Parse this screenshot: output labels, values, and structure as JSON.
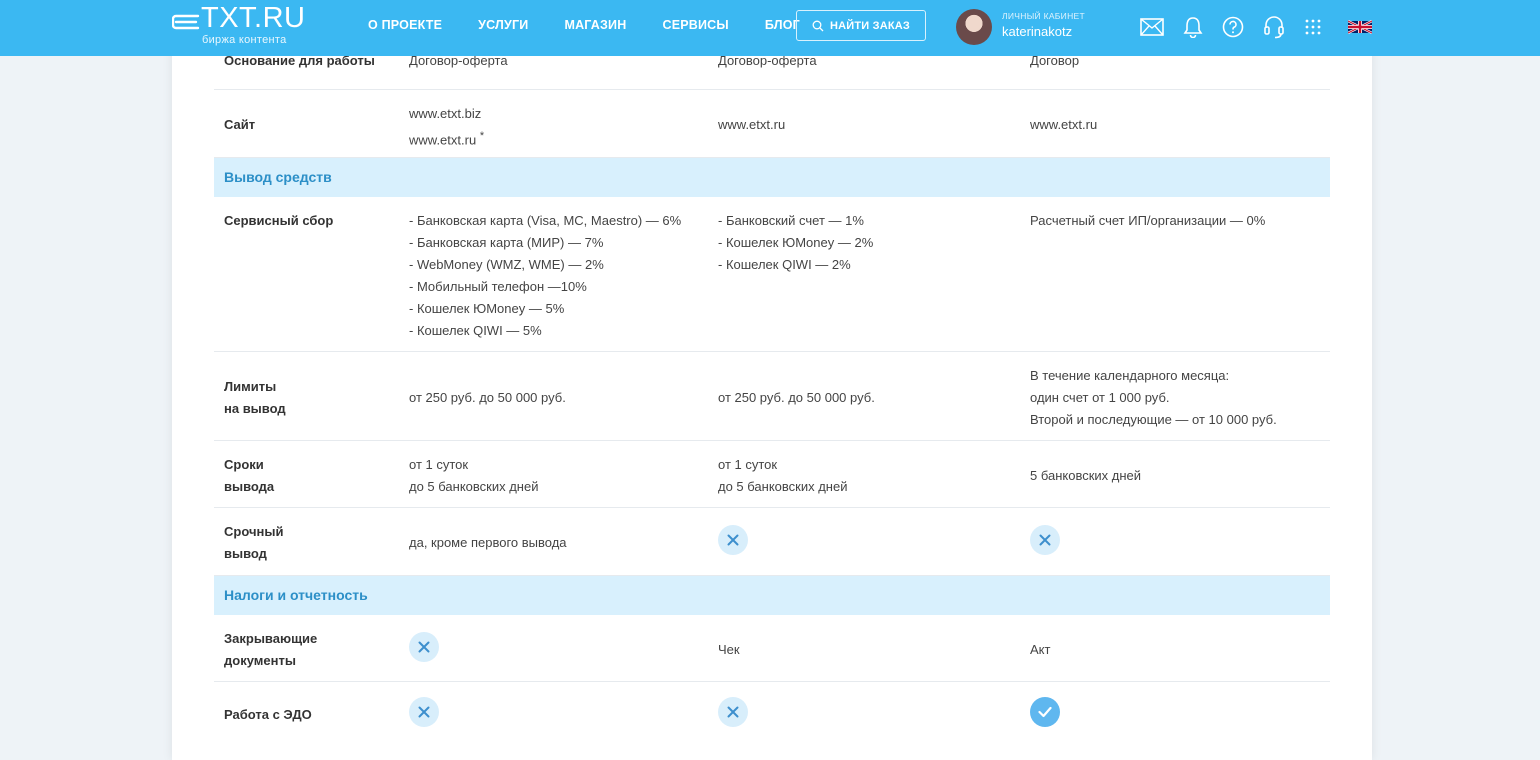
{
  "header": {
    "logo_text": "TXT.RU",
    "logo_sub": "биржа контента",
    "nav": [
      "О ПРОЕКТЕ",
      "УСЛУГИ",
      "МАГАЗИН",
      "СЕРВИСЫ",
      "БЛОГ"
    ],
    "search_label": "НАЙТИ ЗАКАЗ",
    "cabinet_label": "ЛИЧНЫЙ КАБИНЕТ",
    "username": "katerinakotz",
    "icons": [
      "mail-icon",
      "bell-icon",
      "help-icon",
      "support-headset-icon",
      "apps-grid-icon",
      "uk-flag-icon"
    ]
  },
  "table": {
    "rows": {
      "basis": {
        "label": "Основание для работы",
        "c1": "Договор-оферта",
        "c2": "Договор-оферта",
        "c3": "Договор"
      },
      "site": {
        "label": "Сайт",
        "c1_line1": "www.etxt.biz",
        "c1_line2": "www.etxt.ru",
        "c1_note": "*",
        "c2": "www.etxt.ru",
        "c3": "www.etxt.ru"
      },
      "fee": {
        "label": "Сервисный сбор",
        "c1": [
          "- Банковская карта (Visa, MC, Maestro) — 6%",
          "- Банковская карта (МИР) — 7%",
          "- WebMoney (WMZ, WME) — 2%",
          "- Мобильный телефон —10%",
          "- Кошелек ЮMoney — 5%",
          "- Кошелек QIWI — 5%"
        ],
        "c2": [
          "- Банковский счет — 1%",
          "- Кошелек ЮMoney — 2%",
          "- Кошелек QIWI — 2%"
        ],
        "c3": "Расчетный счет ИП/организации — 0%"
      },
      "limits": {
        "label_line1": "Лимиты",
        "label_line2": "на вывод",
        "c1": "от 250 руб. до 50 000 руб.",
        "c2": "от 250 руб. до 50 000 руб.",
        "c3": [
          "В течение календарного месяца:",
          "один счет от 1 000 руб.",
          "Второй и последующие — от 10 000 руб."
        ]
      },
      "terms": {
        "label_line1": "Сроки",
        "label_line2": "вывода",
        "c1": [
          "от 1 суток",
          "до 5 банковских дней"
        ],
        "c2": [
          "от 1 суток",
          "до 5 банковских дней"
        ],
        "c3": "5 банковских дней"
      },
      "urgent": {
        "label_line1": "Срочный",
        "label_line2": "вывод",
        "c1": "да, кроме первого вывода",
        "c2": "no",
        "c3": "no"
      },
      "closing_docs": {
        "label_line1": "Закрывающие",
        "label_line2": "документы",
        "c1": "no",
        "c2": "Чек",
        "c3": "Акт"
      },
      "edo": {
        "label": "Работа с ЭДО",
        "c1": "no",
        "c2": "no",
        "c3": "yes"
      }
    },
    "sections": {
      "withdrawal": "Вывод средств",
      "taxes": "Налоги и отчетность"
    }
  },
  "colors": {
    "header_bg": "#3bb8f2",
    "section_bg": "#d8f0fd",
    "section_text": "#2c8fc7",
    "no_mark_bg": "#d8eefb",
    "yes_mark_bg": "#5fb7ef"
  }
}
